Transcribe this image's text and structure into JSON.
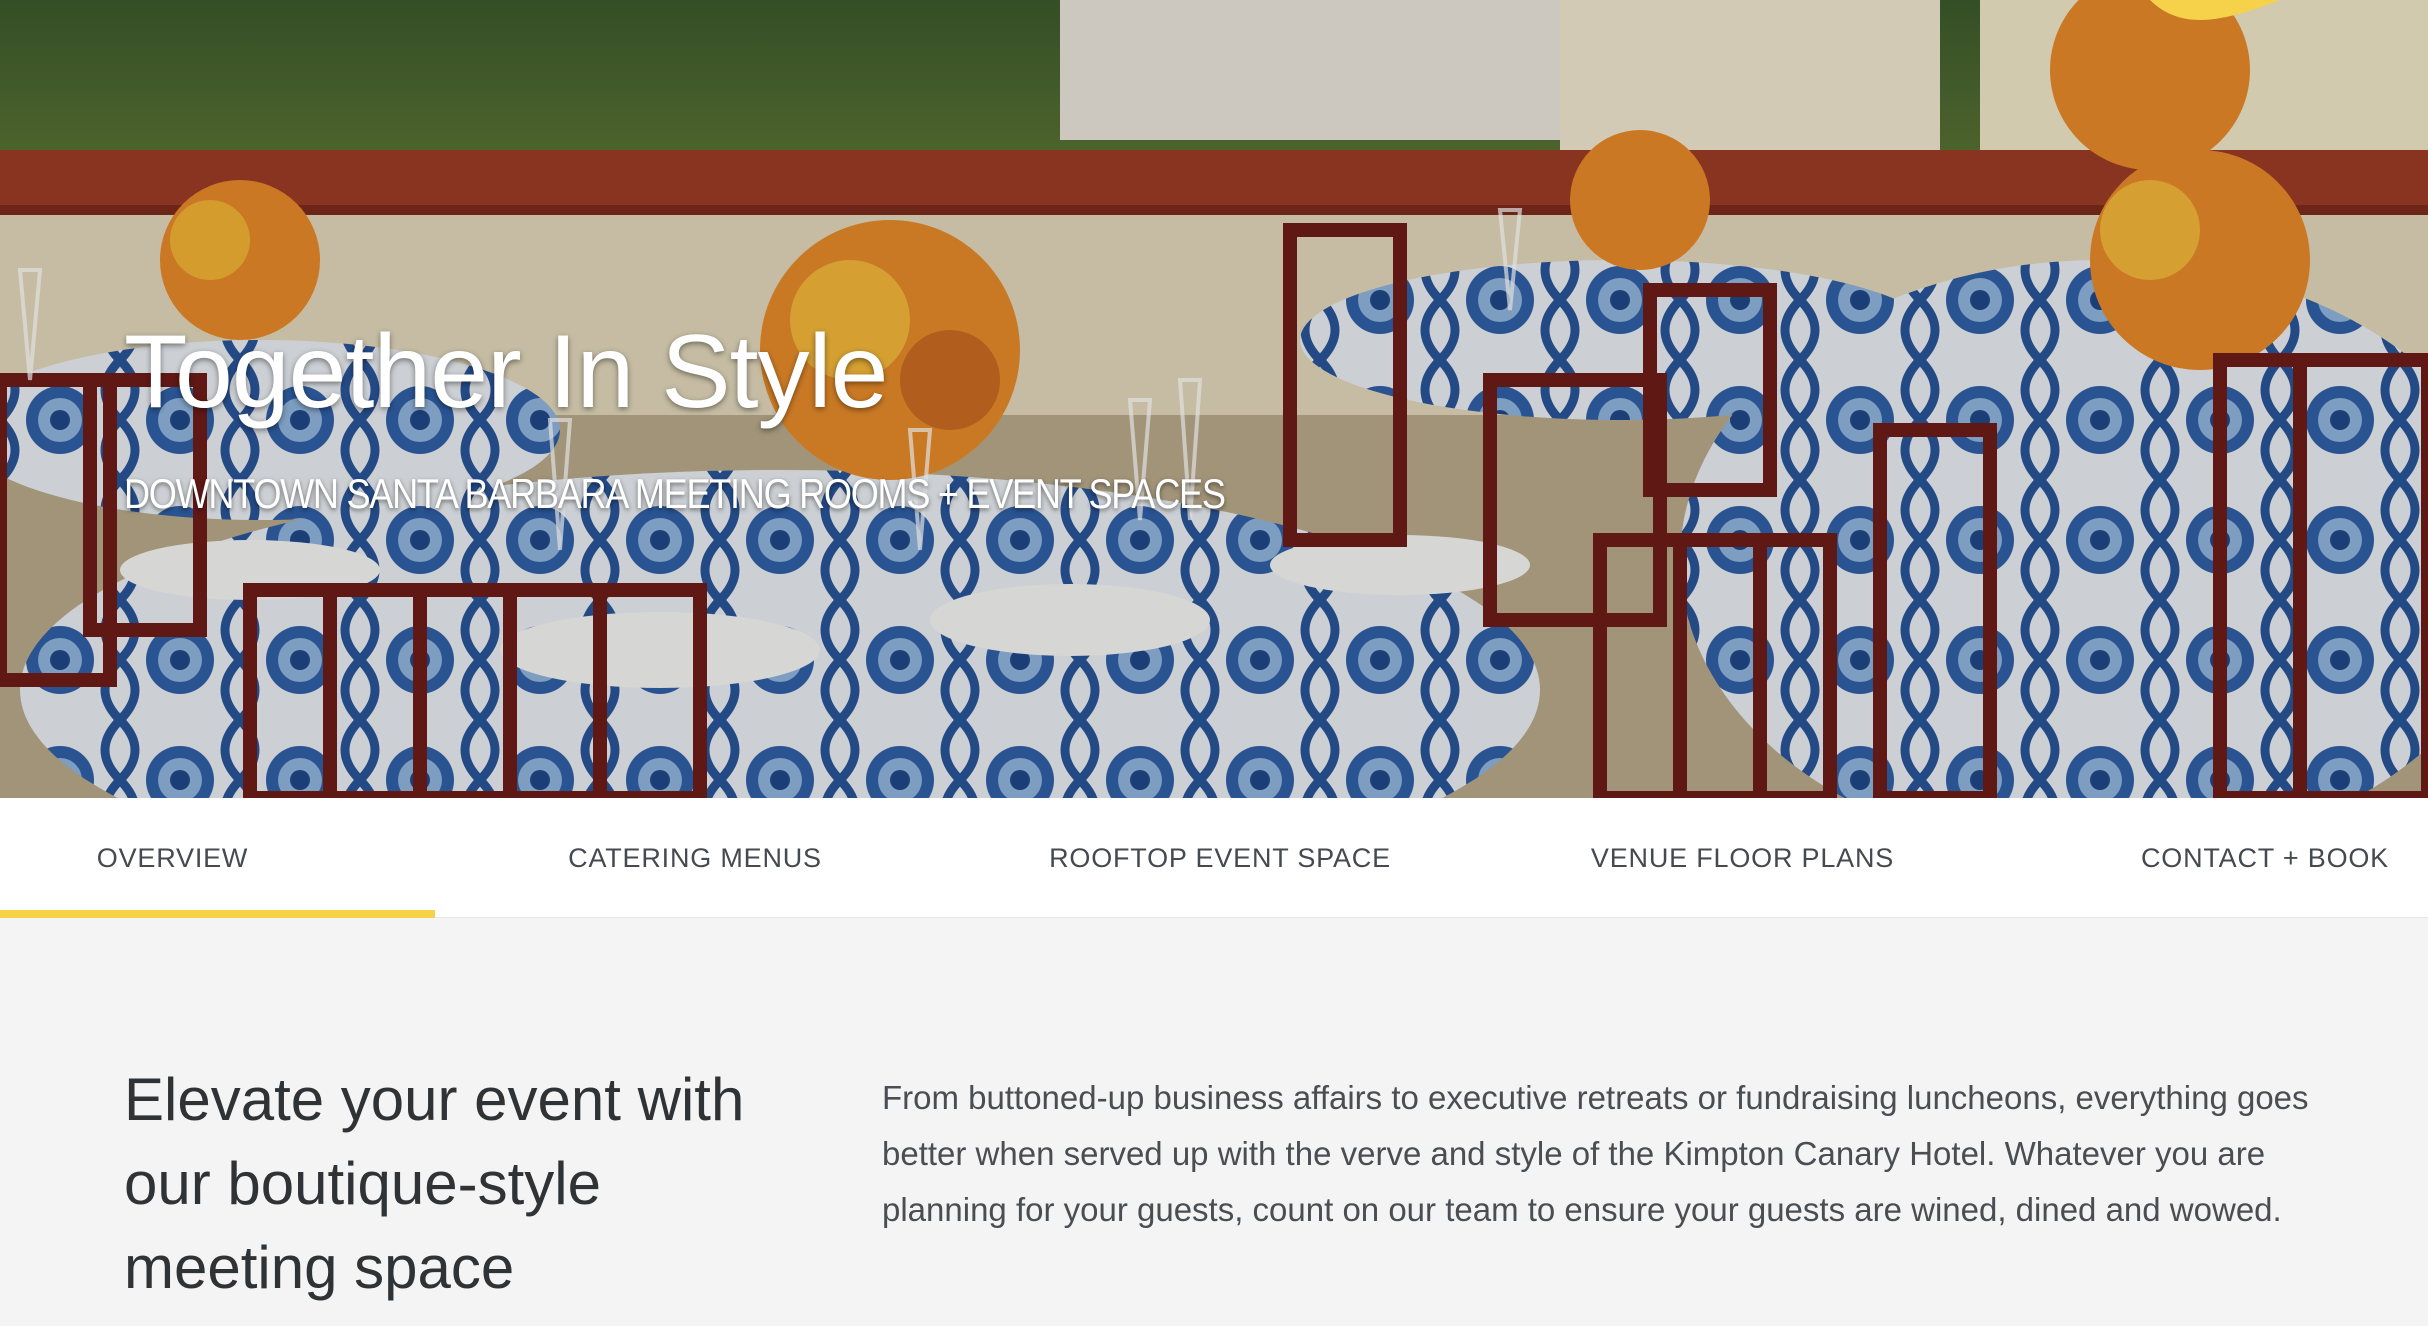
{
  "hero": {
    "title": "Together In Style",
    "subtitle": "DOWNTOWN SANTA BARBARA MEETING ROOMS + EVENT SPACES"
  },
  "tabs": [
    {
      "label": "OVERVIEW",
      "active": true
    },
    {
      "label": "CATERING MENUS",
      "active": false
    },
    {
      "label": "ROOFTOP EVENT SPACE",
      "active": false
    },
    {
      "label": "VENUE FLOOR PLANS",
      "active": false
    },
    {
      "label": "CONTACT + BOOK",
      "active": false
    }
  ],
  "main": {
    "headline": "Elevate your event with our boutique-style meeting space",
    "body": "From buttoned-up business affairs to executive retreats or fundraising luncheons, everything goes better when served up with the verve and style of the Kimpton Canary Hotel. Whatever you are planning for your guests, count on our team to ensure your guests are wined, dined and wowed."
  },
  "colors": {
    "accent": "#f5d24a",
    "tab_text": "#444a50",
    "heading_text": "#2f3336",
    "body_text": "#4a4e52",
    "section_bg": "#f4f4f4"
  }
}
